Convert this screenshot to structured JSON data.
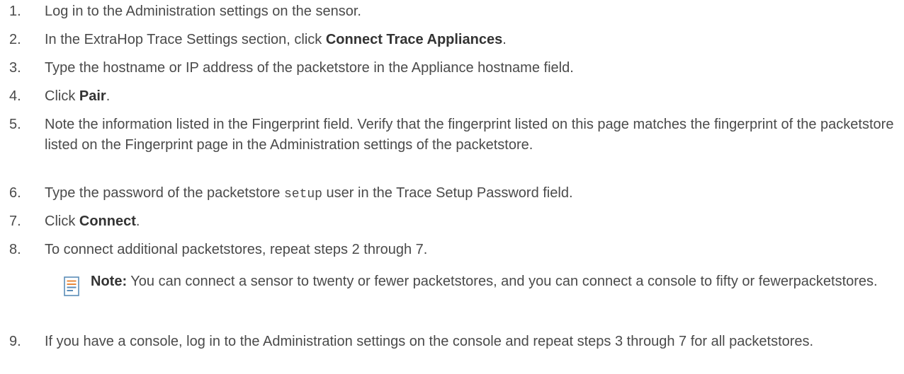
{
  "steps": [
    {
      "num": "1.",
      "text": "Log in to the Administration settings on the sensor."
    },
    {
      "num": "2.",
      "pre": "In the ExtraHop Trace Settings section, click ",
      "bold": "Connect Trace Appliances",
      "post": "."
    },
    {
      "num": "3.",
      "text": "Type the hostname or IP address of the packetstore in the Appliance hostname field."
    },
    {
      "num": "4.",
      "pre": "Click ",
      "bold": "Pair",
      "post": "."
    },
    {
      "num": "5.",
      "text": "Note the information listed in the Fingerprint field. Verify that the fingerprint listed on this page matches the fingerprint of the packetstore listed on the Fingerprint page in the Administration settings of the packetstore."
    },
    {
      "num": "6.",
      "pre": "Type the password of the packetstore ",
      "code": "setup",
      "post": " user in the Trace Setup Password field."
    },
    {
      "num": "7.",
      "pre": "Click ",
      "bold": "Connect",
      "post": "."
    },
    {
      "num": "8.",
      "text": "To connect additional packetstores, repeat steps 2 through 7."
    },
    {
      "num": "9.",
      "text": "If you have a console, log in to the Administration settings on the console and repeat steps 3 through 7 for all packetstores."
    }
  ],
  "note": {
    "icon": "note-icon",
    "label": "Note:",
    "text": " You can connect a sensor to twenty or fewer packetstores, and you can connect a console to fifty or fewerpacketstores."
  }
}
